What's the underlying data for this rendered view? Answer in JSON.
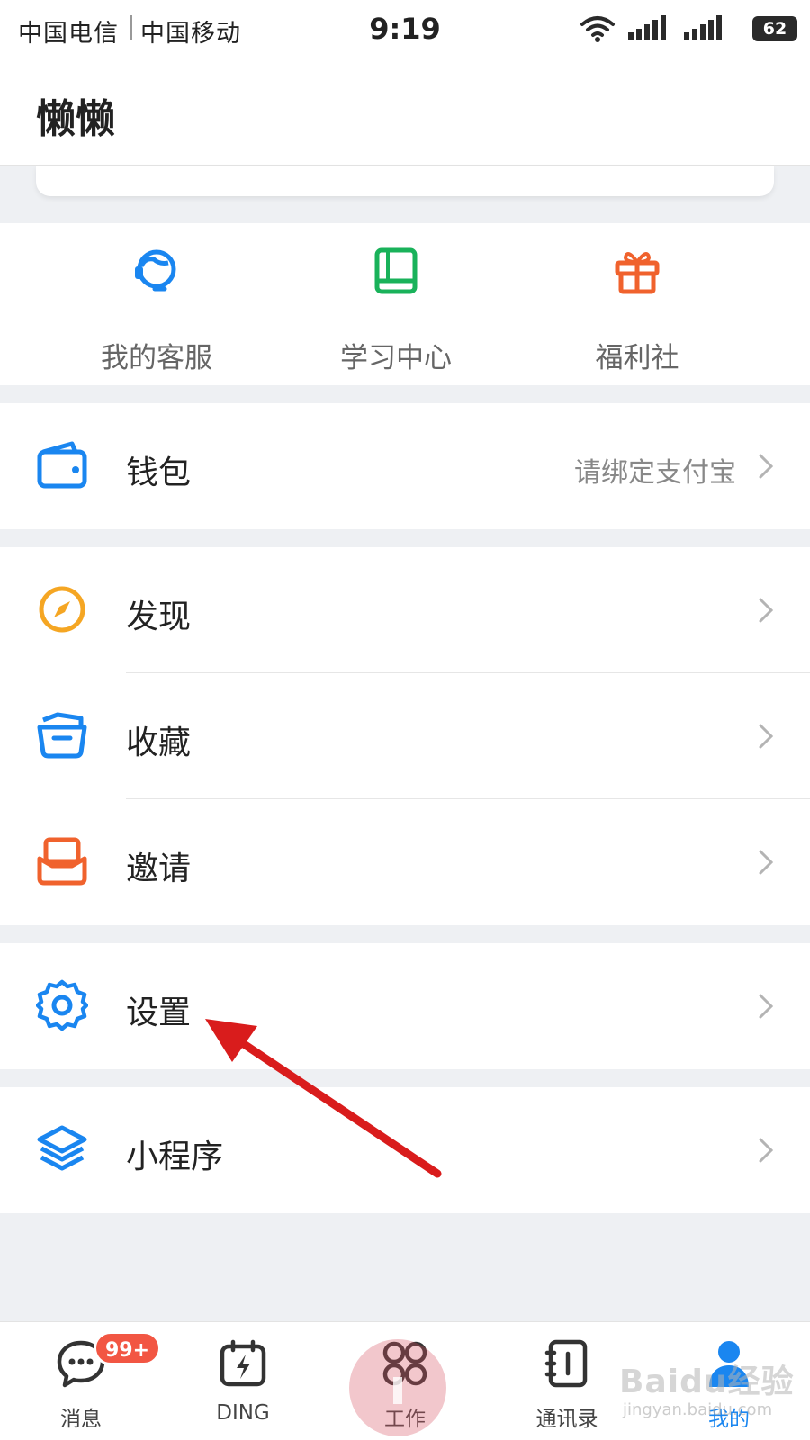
{
  "status_bar": {
    "carrier1": "中国电信",
    "carrier2": "中国移动",
    "time": "9:19",
    "battery": "62",
    "icons": [
      "wifi-icon",
      "signal-icon",
      "signal-icon"
    ]
  },
  "header": {
    "title": "懒懒"
  },
  "quick_entries": [
    {
      "label": "我的客服",
      "icon": "customer-service-icon",
      "color": "#1a86f0"
    },
    {
      "label": "学习中心",
      "icon": "book-icon",
      "color": "#19b25a"
    },
    {
      "label": "福利社",
      "icon": "gift-icon",
      "color": "#f0622d"
    }
  ],
  "wallet": {
    "label": "钱包",
    "value": "请绑定支付宝",
    "icon": "wallet-icon",
    "color": "#1a86f0"
  },
  "menu": [
    {
      "label": "发现",
      "icon": "compass-icon",
      "color": "#f5a623"
    },
    {
      "label": "收藏",
      "icon": "folder-icon",
      "color": "#1a86f0"
    },
    {
      "label": "邀请",
      "icon": "envelope-icon",
      "color": "#f0622d"
    }
  ],
  "settings": {
    "label": "设置",
    "icon": "gear-icon",
    "color": "#1a86f0"
  },
  "mini_programs": {
    "label": "小程序",
    "icon": "layers-icon",
    "color": "#1a86f0"
  },
  "tabs": [
    {
      "label": "消息",
      "icon": "chat-icon",
      "badge": "99+"
    },
    {
      "label": "DING",
      "icon": "ding-icon"
    },
    {
      "label": "工作",
      "icon": "apps-icon"
    },
    {
      "label": "通讯录",
      "icon": "contacts-icon"
    },
    {
      "label": "我的",
      "icon": "user-icon",
      "active": true
    }
  ],
  "watermark": {
    "text": "Baidu经验",
    "sub": "jingyan.baidu.com"
  },
  "colors": {
    "accent": "#1a86f0",
    "annotation_arrow": "#d91c1c",
    "badge": "#f25643"
  }
}
